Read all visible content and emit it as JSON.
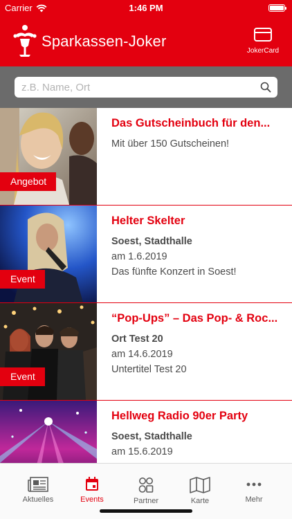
{
  "status_bar": {
    "carrier": "Carrier",
    "time": "1:46 PM"
  },
  "header": {
    "title": "Sparkassen-Joker",
    "jokercard_label": "JokerCard"
  },
  "search": {
    "placeholder": "z.B. Name, Ort"
  },
  "events": [
    {
      "title": "Das Gutscheinbuch für den...",
      "lines": [
        "Mit über 150 Gutscheinen!"
      ],
      "bold_first": false,
      "badge": "Angebot"
    },
    {
      "title": "Helter Skelter",
      "lines": [
        "Soest, Stadthalle",
        "am 1.6.2019",
        "Das fünfte Konzert in Soest!"
      ],
      "bold_first": true,
      "badge": "Event"
    },
    {
      "title": "“Pop-Ups” – Das Pop- & Roc...",
      "lines": [
        "Ort Test 20",
        "am 14.6.2019",
        "Untertitel Test 20"
      ],
      "bold_first": true,
      "badge": "Event"
    },
    {
      "title": "Hellweg Radio 90er Party",
      "lines": [
        "Soest, Stadthalle",
        "am 15.6.2019"
      ],
      "bold_first": true,
      "badge": ""
    }
  ],
  "tabs": [
    {
      "label": "Aktuelles",
      "icon": "newspaper-icon",
      "active": false
    },
    {
      "label": "Events",
      "icon": "calendar-icon",
      "active": true
    },
    {
      "label": "Partner",
      "icon": "partner-icon",
      "active": false
    },
    {
      "label": "Karte",
      "icon": "map-icon",
      "active": false
    },
    {
      "label": "Mehr",
      "icon": "more-icon",
      "active": false
    }
  ],
  "colors": {
    "brand_red": "#e3000f",
    "search_bar_bg": "#6b6b6b",
    "tab_inactive": "#5c5c5c"
  }
}
